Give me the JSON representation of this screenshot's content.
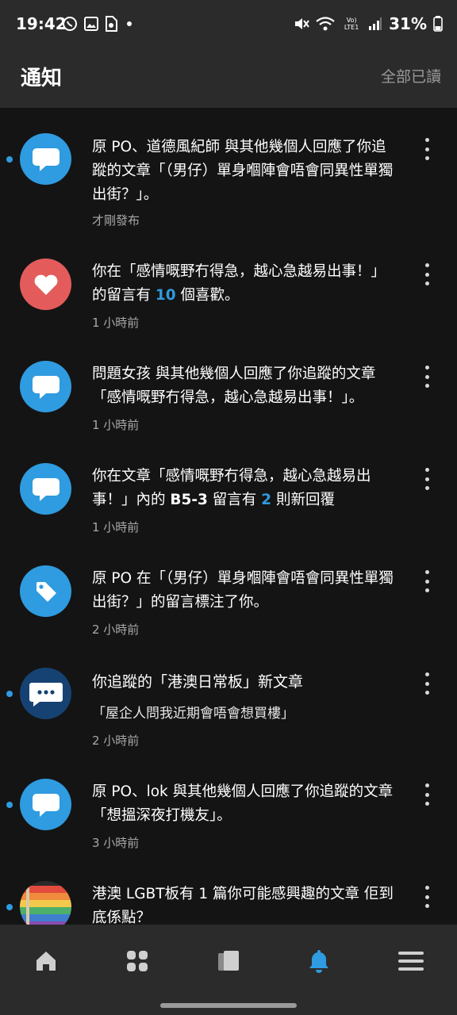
{
  "status_bar": {
    "time": "19:42",
    "battery": "31%",
    "network": "Vo) LTE1"
  },
  "header": {
    "title": "通知",
    "mark_all_read": "全部已讀"
  },
  "colors": {
    "accent": "#2f9be0",
    "like": "#e45b5b",
    "board_dark": "#154272"
  },
  "notifications": [
    {
      "icon": "comment-icon",
      "unread": true,
      "segments": [
        "原 PO、道德風紀師 與其他幾個人回應了你追蹤的文章「（男仔）單身嗰陣會唔會同異性單獨出街？」。"
      ],
      "time": "才剛發布"
    },
    {
      "icon": "heart-icon",
      "unread": false,
      "segments": [
        "你在「感情嘅野冇得急，越心急越易出事！」的留言有 ",
        "10",
        " 個喜歡。"
      ],
      "time": "1 小時前"
    },
    {
      "icon": "comment-icon",
      "unread": false,
      "segments": [
        "問題女孩 與其他幾個人回應了你追蹤的文章「感情嘅野冇得急，越心急越易出事！」。"
      ],
      "time": "1 小時前"
    },
    {
      "icon": "comment-icon",
      "unread": false,
      "segments": [
        "你在文章「感情嘅野冇得急，越心急越易出事！」內的 ",
        "B5-3",
        " 留言有 ",
        "2",
        " 則新回覆"
      ],
      "time": "1 小時前"
    },
    {
      "icon": "tag-icon",
      "unread": false,
      "segments": [
        "原 PO 在「（男仔）單身嗰陣會唔會同異性單獨出街？」的留言標注了你。"
      ],
      "time": "2 小時前"
    },
    {
      "icon": "board-icon",
      "unread": true,
      "title": "你追蹤的「港澳日常板」新文章",
      "subtitle": "「屋企人問我近期會唔會想買樓」",
      "time": "2 小時前"
    },
    {
      "icon": "comment-icon",
      "unread": true,
      "segments": [
        "原 PO、lok 與其他幾個人回應了你追蹤的文章「想搵深夜打機友」。"
      ],
      "time": "3 小時前"
    },
    {
      "icon": "rainbow-flag-icon",
      "unread": true,
      "segments": [
        "港澳 LGBT板有 1 篇你可能感興趣的文章 佢到底係點？"
      ],
      "time": ""
    }
  ],
  "bottom_nav": [
    "home-icon",
    "boards-icon",
    "cards-icon",
    "bell-icon",
    "menu-icon"
  ]
}
